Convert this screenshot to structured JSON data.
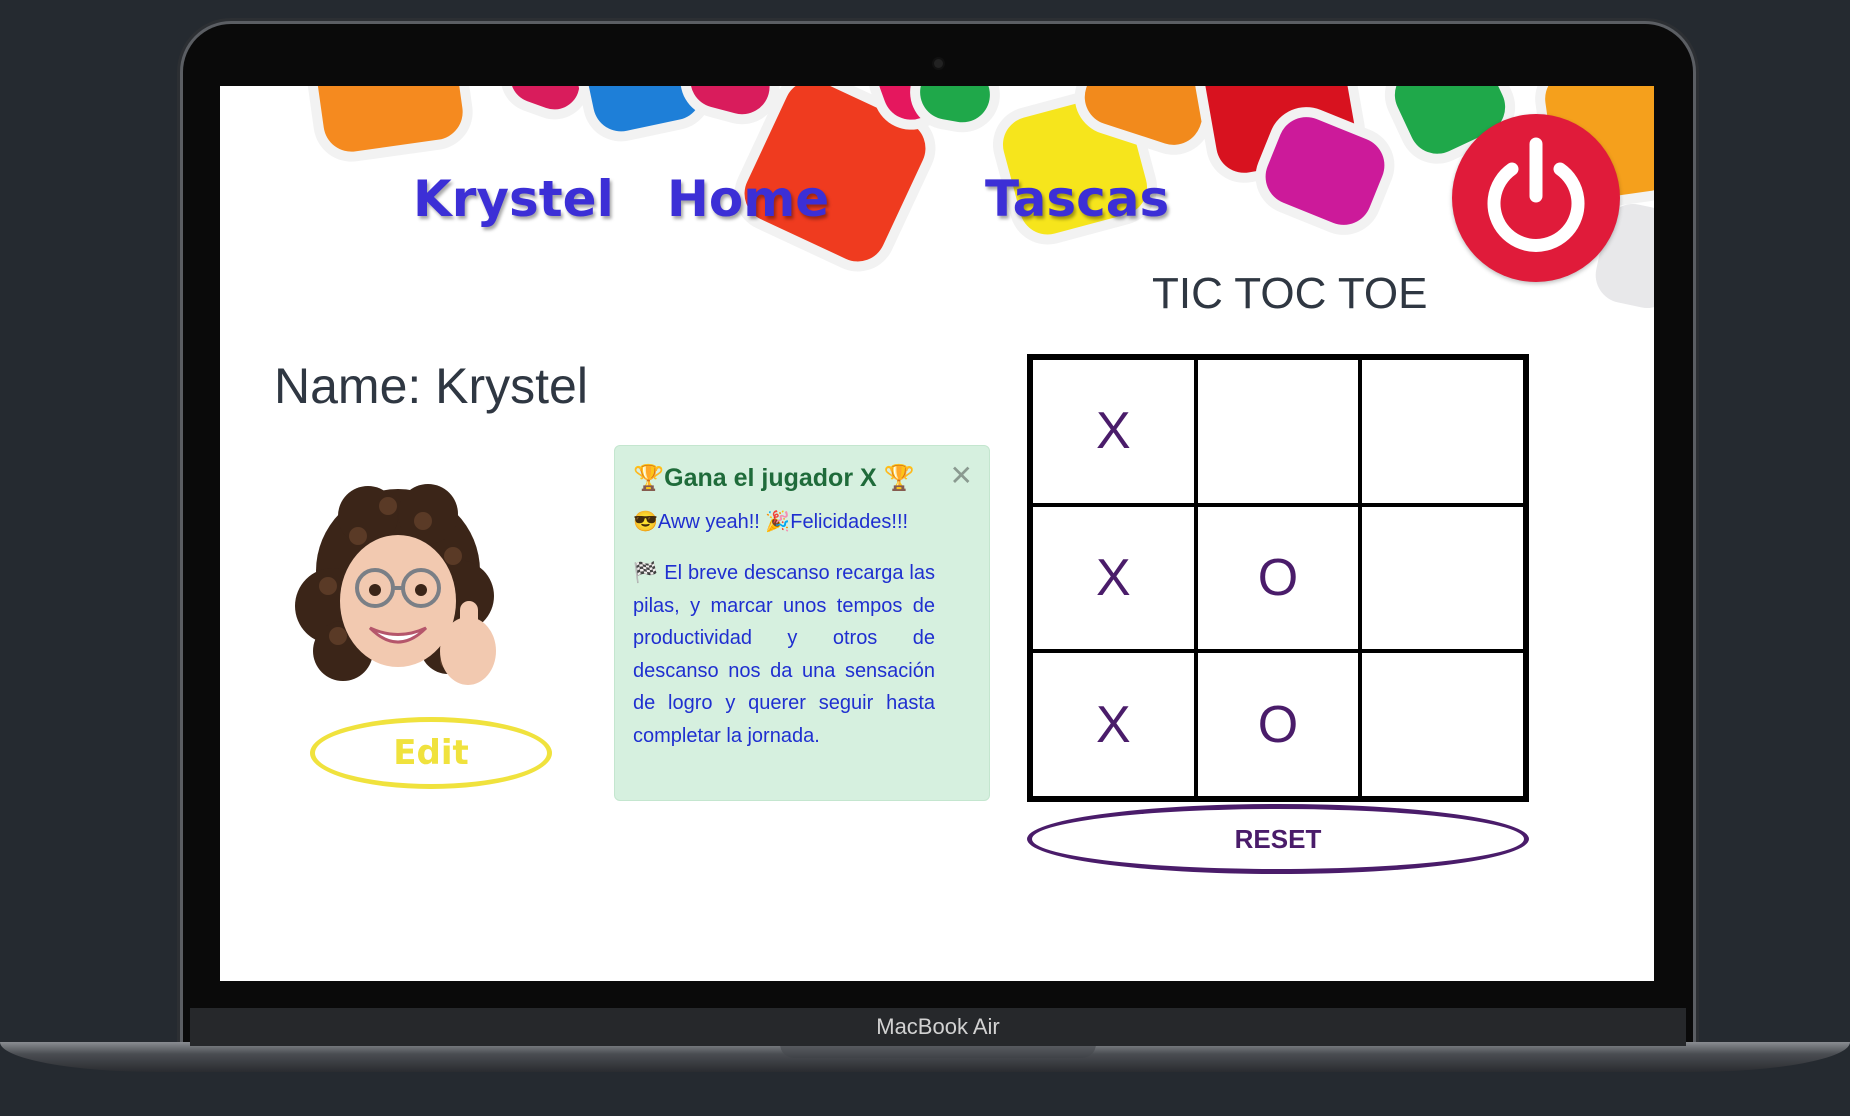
{
  "device": {
    "label": "MacBook Air"
  },
  "nav": {
    "links": [
      {
        "label": "Krystel"
      },
      {
        "label": "Home"
      },
      {
        "label": "Tascas"
      }
    ],
    "power_icon": "power-icon",
    "power_color": "#e01b3a"
  },
  "game": {
    "title": "TIC TOC TOE",
    "cells": [
      "X",
      "",
      "",
      "X",
      "O",
      "",
      "X",
      "O",
      ""
    ],
    "reset_label": "RESET"
  },
  "profile": {
    "name_heading": "Name: Krystel",
    "avatar_icon": "avatar-memoji-thumbs-up",
    "edit_label": "Edit"
  },
  "alert": {
    "title": "🏆Gana el jugador X 🏆",
    "subtitle": "😎Aww yeah!! 🎉Felicidades!!!",
    "body": "🏁 El breve descanso recarga las pilas, y marcar unos tempos de productividad y otros de descanso nos da una sensación de logro y querer seguir hasta completar la jornada.",
    "close_icon": "close-icon"
  },
  "colors": {
    "nav_link": "#3c2fd6",
    "edit": "#f0e23d",
    "reset": "#4a1c6a",
    "alert_bg": "#d6f0df"
  }
}
